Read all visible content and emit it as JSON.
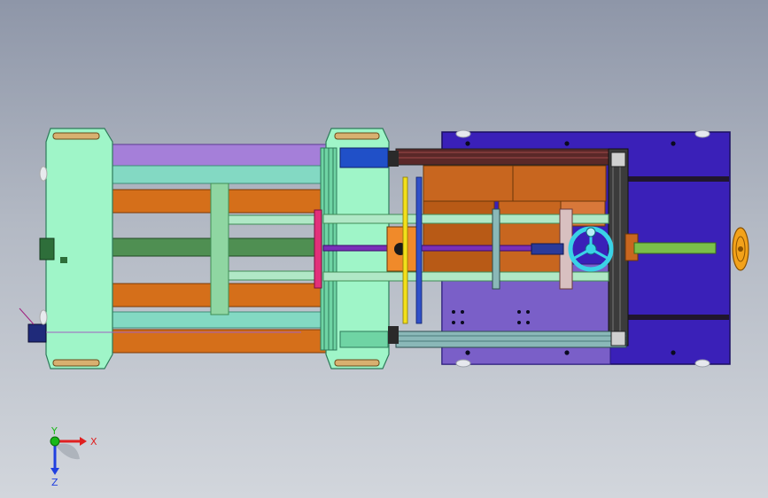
{
  "view": {
    "axes": {
      "x": "X",
      "y": "Y",
      "z": "Z"
    }
  },
  "colors": {
    "platen_mint": "#9ff5c8",
    "platen_mint_dark": "#6fd4a4",
    "rod_orange": "#d56f1a",
    "rod_purple": "#a57fd9",
    "rod_teal": "#83d9c3",
    "rod_green": "#4f8f52",
    "base_plate": "#3a20b8",
    "base_plate_light": "#7a5fc8",
    "mold_block": "#c8661f",
    "frame_dark": "#3b3b3b",
    "handwheel": "#3ad2e6",
    "handwheel_end": "#f3a21a",
    "highlight_pink": "#e2307a",
    "axis_x": "#e02020",
    "axis_y": "#18b818",
    "axis_z": "#2040e0"
  },
  "icons": [
    "coordinate-triad-icon",
    "handwheel-icon",
    "handwheel-end-icon"
  ]
}
